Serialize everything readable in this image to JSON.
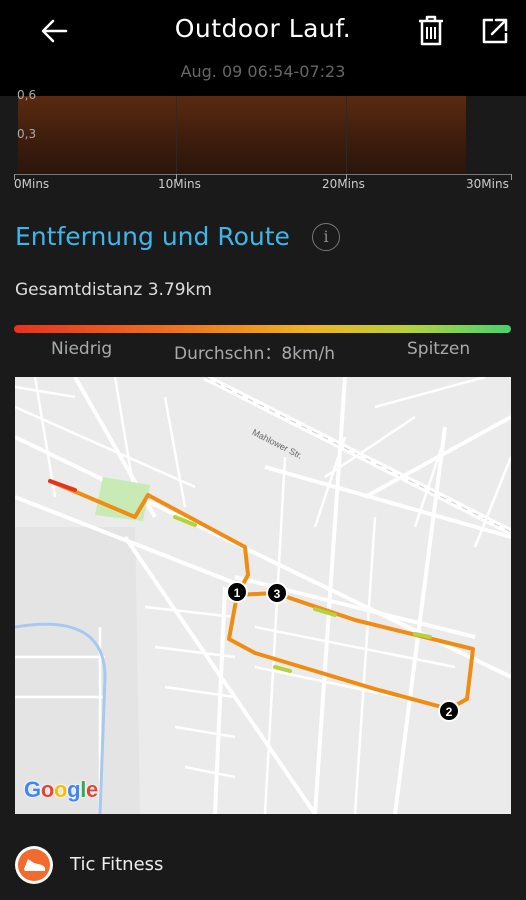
{
  "header": {
    "title": "Outdoor Lauf.",
    "subtitle": "Aug. 09 06:54-07:23",
    "back_icon": "arrow-left-icon",
    "delete_icon": "trash-icon",
    "share_icon": "share-external-icon"
  },
  "chart": {
    "y_labels": [
      "0,6",
      "0,3"
    ],
    "x_labels": [
      "0Mins",
      "10Mins",
      "20Mins",
      "30Mins"
    ],
    "fill_color": "#5a2a10"
  },
  "chart_data": {
    "type": "area",
    "categories": [
      "0Mins",
      "10Mins",
      "20Mins",
      "30Mins"
    ],
    "yticks": [
      "0,6",
      "0,3"
    ],
    "xlabel": "",
    "ylabel": ""
  },
  "route": {
    "section_title": "Entfernung und Route",
    "info_icon": "info-icon",
    "total_distance": "Gesamtdistanz 3.79km",
    "legend_low": "Niedrig",
    "legend_avg": "Durchschn：8km/h",
    "legend_peak": "Spitzen",
    "gradient_colors": [
      "#e8321e",
      "#f0781e",
      "#f0b41e",
      "#b4d23c",
      "#46d26e"
    ]
  },
  "map": {
    "street_label": "Mahlower Str.",
    "provider": "Google",
    "markers": [
      "1",
      "2",
      "3"
    ],
    "route_color": "#f08c14"
  },
  "footer": {
    "app_name": "Tic Fitness",
    "app_icon": "tic-fitness-shoe-icon"
  }
}
